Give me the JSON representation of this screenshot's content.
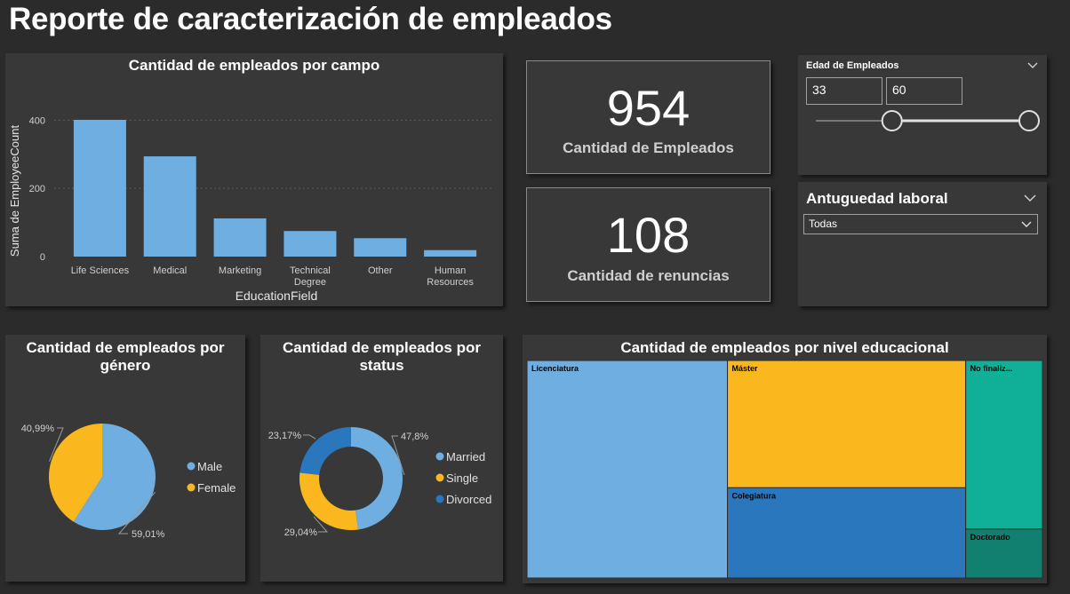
{
  "report_title": "Reporte de caracterización de empleados",
  "colors": {
    "blue": "#6eaee0",
    "gold": "#fbb81e",
    "darkblue": "#2a77be",
    "teal": "#10b098",
    "darkteal": "#128070"
  },
  "bar_panel": {
    "title": "Cantidad de empleados por campo",
    "xlabel": "EducationField",
    "ylabel": "Suma de EmployeeCount"
  },
  "kpis": {
    "employees": {
      "value": "954",
      "label": "Cantidad de Empleados"
    },
    "resignations": {
      "value": "108",
      "label": "Cantidad de renuncias"
    }
  },
  "age_slicer": {
    "title": "Edad de Empleados",
    "min_value": "33",
    "max_value": "60",
    "range_low": 33,
    "range_high": 60,
    "range_min": 18,
    "range_max": 60,
    "chevron": "chevron-down-icon"
  },
  "tenure_slicer": {
    "title": "Antuguedad laboral",
    "selected": "Todas",
    "chevron": "chevron-down-icon"
  },
  "gender_panel": {
    "title": "Cantidad de empleados por género"
  },
  "status_panel": {
    "title": "Cantidad de empleados por status"
  },
  "tree_panel": {
    "title": "Cantidad de empleados por nivel educacional"
  },
  "chart_data": [
    {
      "type": "bar",
      "title": "Cantidad de empleados por campo",
      "categories": [
        "Life Sciences",
        "Medical",
        "Marketing",
        "Technical Degree",
        "Other",
        "Human Resources"
      ],
      "values": [
        401,
        294,
        112,
        75,
        54,
        19
      ],
      "xlabel": "EducationField",
      "ylabel": "Suma de EmployeeCount",
      "yticks": [
        0,
        200,
        400
      ],
      "ylim": [
        0,
        440
      ],
      "grid": true
    },
    {
      "type": "pie",
      "title": "Cantidad de empleados por género",
      "labels": [
        "Male",
        "Female"
      ],
      "values": [
        59.01,
        40.99
      ],
      "value_labels": [
        "59,01%",
        "40,99%"
      ],
      "colors": [
        "#6eaee0",
        "#fbb81e"
      ],
      "legend": "right"
    },
    {
      "type": "pie",
      "subtype": "donut",
      "title": "Cantidad de empleados por status",
      "labels": [
        "Married",
        "Single",
        "Divorced"
      ],
      "values": [
        47.8,
        29.04,
        23.17
      ],
      "value_labels": [
        "47,8%",
        "29,04%",
        "23,17%"
      ],
      "colors": [
        "#6eaee0",
        "#fbb81e",
        "#2a77be"
      ],
      "legend": "right"
    },
    {
      "type": "treemap",
      "title": "Cantidad de empleados por nivel educacional",
      "labels": [
        "Licenciatura",
        "Máster",
        "Colegiatura",
        "No finaliz...",
        "Doctorado"
      ],
      "values": [
        371,
        258,
        183,
        110,
        32
      ],
      "colors": [
        "#6eaee0",
        "#fbb81e",
        "#2a77be",
        "#10b098",
        "#128070"
      ]
    }
  ]
}
